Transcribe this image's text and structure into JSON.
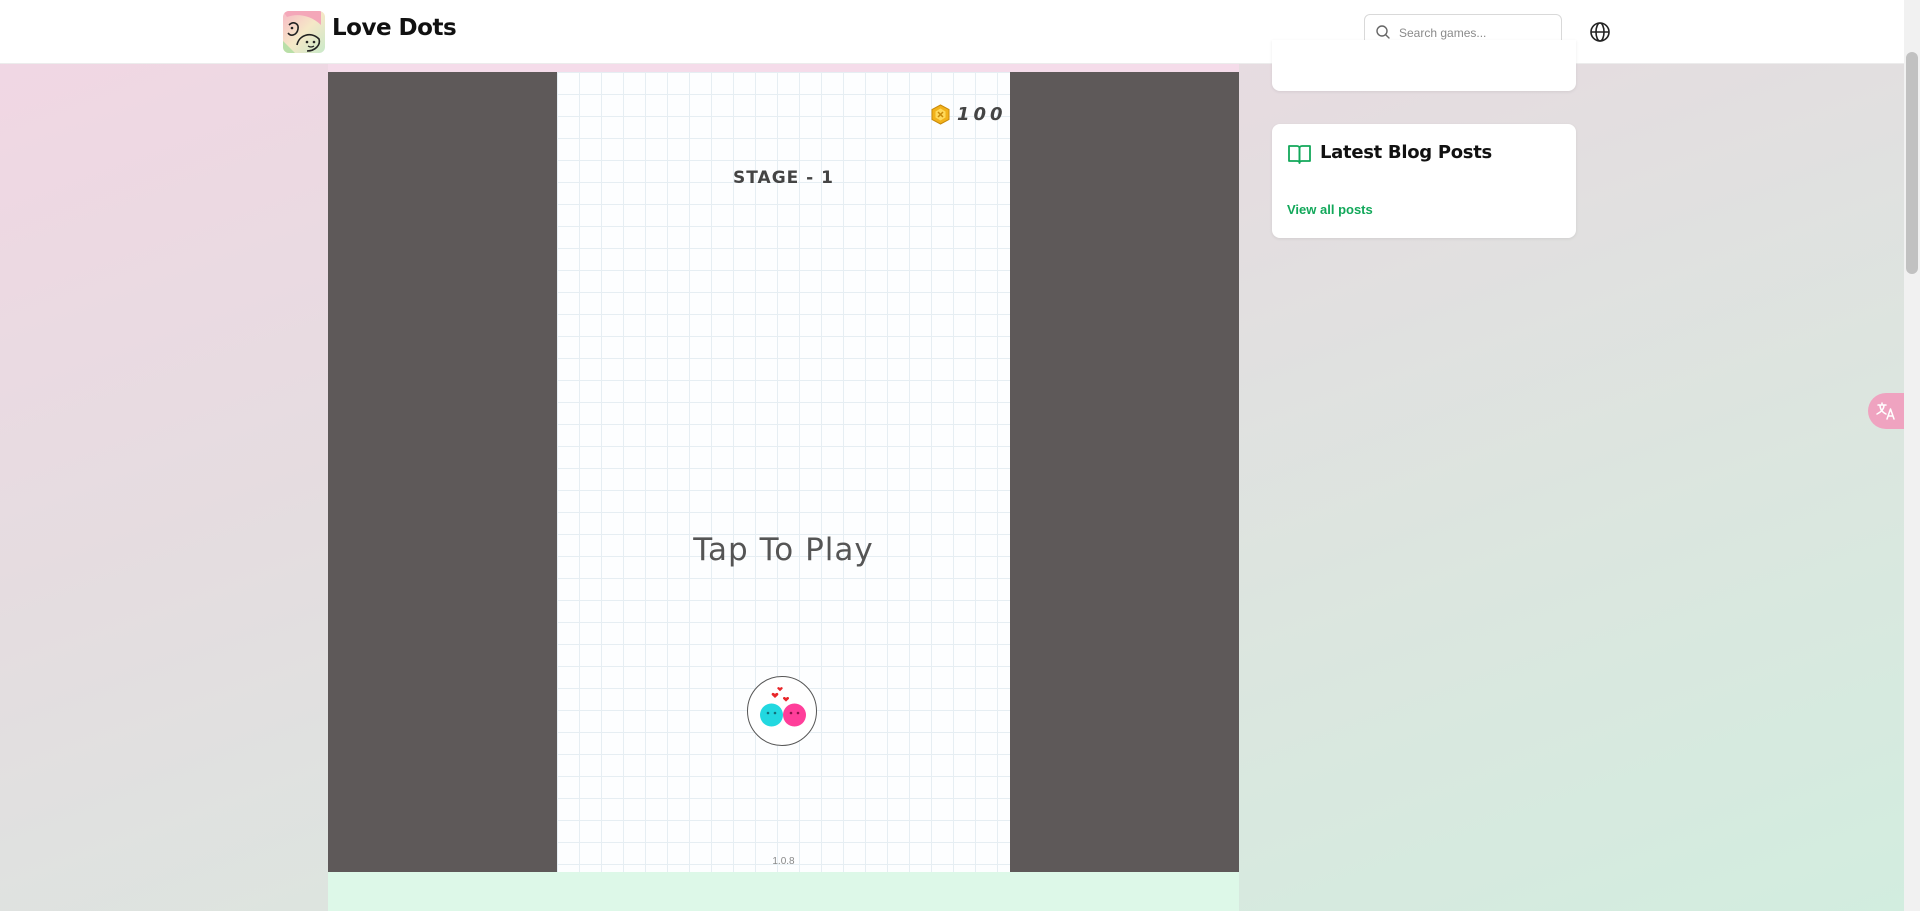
{
  "header": {
    "site_title": "Love Dots",
    "search_placeholder": "Search games..."
  },
  "game": {
    "coins": "100",
    "stage": "STAGE - 1",
    "tap_to_play": "Tap To Play",
    "version": "1.0.8"
  },
  "sidebar": {
    "blog_title": "Latest Blog Posts",
    "view_all": "View all posts"
  },
  "colors": {
    "accent_green": "#12a85a",
    "game_frame": "#5e5959",
    "dot_cyan": "#22d8e0",
    "dot_pink": "#ff3e9a",
    "heart_red": "#e8262a"
  }
}
